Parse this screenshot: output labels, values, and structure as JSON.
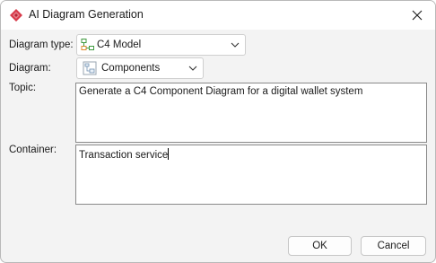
{
  "window": {
    "title": "AI Diagram Generation",
    "icon": "diamond-logo-icon",
    "close_icon": "close-icon"
  },
  "form": {
    "diagram_type": {
      "label": "Diagram type:",
      "value": "C4 Model",
      "icon": "c4-model-icon"
    },
    "diagram": {
      "label": "Diagram:",
      "value": "Components",
      "icon": "component-diagram-icon"
    },
    "topic": {
      "label": "Topic:",
      "value": "Generate a C4 Component Diagram for a digital wallet system"
    },
    "container": {
      "label": "Container:",
      "value": "Transaction service"
    }
  },
  "buttons": {
    "ok": "OK",
    "cancel": "Cancel"
  },
  "colors": {
    "logo": "#d83a4a",
    "dialog_background": "#f3f3f3"
  }
}
